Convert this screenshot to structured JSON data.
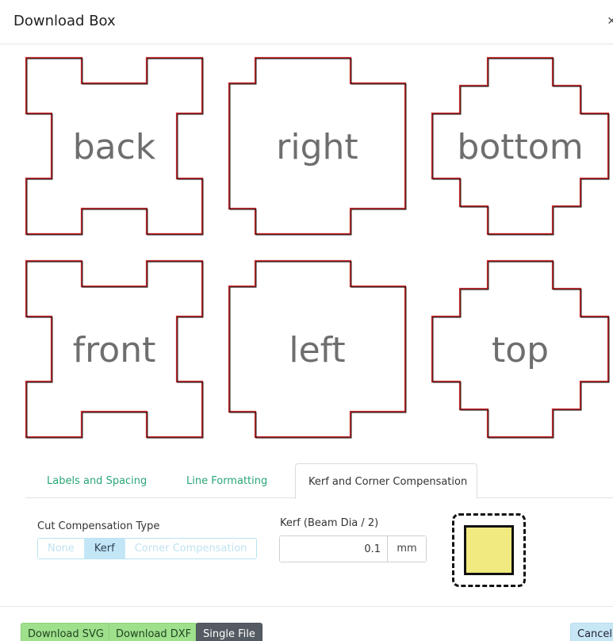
{
  "dialog": {
    "title": "Download Box",
    "close_glyph": "×"
  },
  "panels": [
    {
      "label": "back",
      "shape": "cross"
    },
    {
      "label": "right",
      "shape": "cross"
    },
    {
      "label": "bottom",
      "shape": "octagon-step"
    },
    {
      "label": "front",
      "shape": "cross"
    },
    {
      "label": "left",
      "shape": "cross"
    },
    {
      "label": "top",
      "shape": "octagon-step"
    }
  ],
  "tabs": [
    {
      "label": "Labels and Spacing",
      "active": false
    },
    {
      "label": "Line Formatting",
      "active": false
    },
    {
      "label": "Kerf and Corner Compensation",
      "active": true
    }
  ],
  "cut_compensation": {
    "label": "Cut Compensation Type",
    "options": [
      "None",
      "Kerf",
      "Corner Compensation"
    ],
    "selected": "Kerf"
  },
  "kerf": {
    "label": "Kerf (Beam Dia / 2)",
    "value": "0.1",
    "unit": "mm"
  },
  "footer": {
    "download_svg": "Download SVG",
    "download_dxf": "Download DXF",
    "single_file": "Single File",
    "cancel": "Cancel"
  },
  "colors": {
    "cut_line_outer": "#c0282a",
    "cut_line_inner": "#111111",
    "label_gray": "#6e6e6e",
    "accent_green": "#2aa675",
    "kerf_fill": "#f0ea80"
  }
}
